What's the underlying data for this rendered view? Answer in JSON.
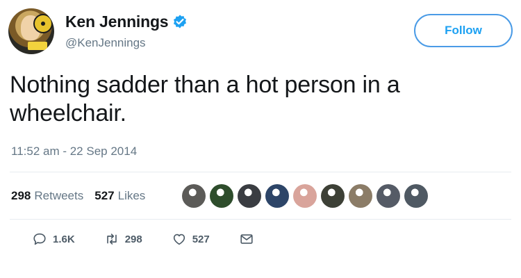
{
  "tweet": {
    "author": {
      "display_name": "Ken Jennings",
      "handle": "@KenJennings",
      "verified": true,
      "avatar_icon": "profile-photo"
    },
    "follow_label": "Follow",
    "text": "Nothing sadder than a hot person in a wheelchair.",
    "timestamp": "11:52 am - 22 Sep 2014",
    "stats": {
      "retweets_count": "298",
      "retweets_label": "Retweets",
      "likes_count": "527",
      "likes_label": "Likes"
    },
    "liker_avatars": [
      {
        "color": "#5c5b58"
      },
      {
        "color": "#2e4d2c"
      },
      {
        "color": "#3a3d42"
      },
      {
        "color": "#2d4568"
      },
      {
        "color": "#d9a49b"
      },
      {
        "color": "#3d4036"
      },
      {
        "color": "#8b7c67"
      },
      {
        "color": "#555b66"
      },
      {
        "color": "#4f5963"
      }
    ],
    "actions": {
      "reply_count": "1.6K",
      "retweet_count": "298",
      "like_count": "527"
    },
    "colors": {
      "accent": "#1da1f2",
      "secondary_text": "#657786"
    }
  }
}
